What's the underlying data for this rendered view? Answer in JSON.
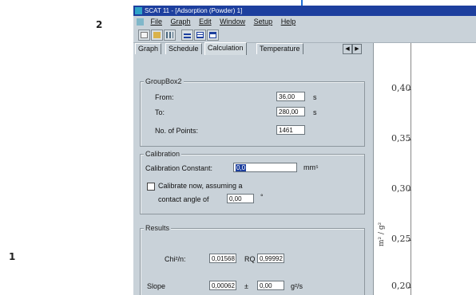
{
  "callouts": {
    "top": "2",
    "bottom": "1"
  },
  "window": {
    "title": "SCAT 11 - [Adsorption (Powder) 1]",
    "menu": [
      "File",
      "Graph",
      "Edit",
      "Window",
      "Setup",
      "Help"
    ],
    "toolbar_icons": [
      "new-file-icon",
      "open-folder-icon",
      "grid-icon",
      "align-icon",
      "table-icon",
      "window-icon"
    ]
  },
  "tabs": [
    "Graph",
    "Schedule",
    "Calculation",
    "Temperature"
  ],
  "active_tab": "Calculation",
  "groupbox2": {
    "title": "GroupBox2",
    "from_label": "From:",
    "from_value": "36,00",
    "from_unit": "s",
    "to_label": "To:",
    "to_value": "280,00",
    "to_unit": "s",
    "points_label": "No. of Points:",
    "points_value": "1461"
  },
  "calibration": {
    "title": "Calibration",
    "constant_label": "Calibration Constant:",
    "constant_value": "0,0",
    "constant_unit": "mm⁵",
    "checkbox_label_1": "Calibrate now, assuming a",
    "checkbox_label_2": "contact angle of",
    "angle_value": "0,00",
    "angle_unit": "°"
  },
  "results": {
    "title": "Results",
    "chi_label": "Chi²/n:",
    "chi_value": "0,01568",
    "rq_label": "RQ",
    "rq_value": "0,99992",
    "slope_label": "Slope",
    "slope_value": "0,00062",
    "slope_pm": "±",
    "slope_err": "0,00",
    "slope_unit": "g²/s"
  },
  "plot": {
    "y_ticks": [
      "0,40",
      "0,35",
      "0,30",
      "0,25",
      "0,20"
    ],
    "y_label": "m² / g²"
  },
  "colors": {
    "titlebar": "#1d3f9e",
    "panel": "#c9d2d9",
    "selection": "#1d3f9e"
  }
}
